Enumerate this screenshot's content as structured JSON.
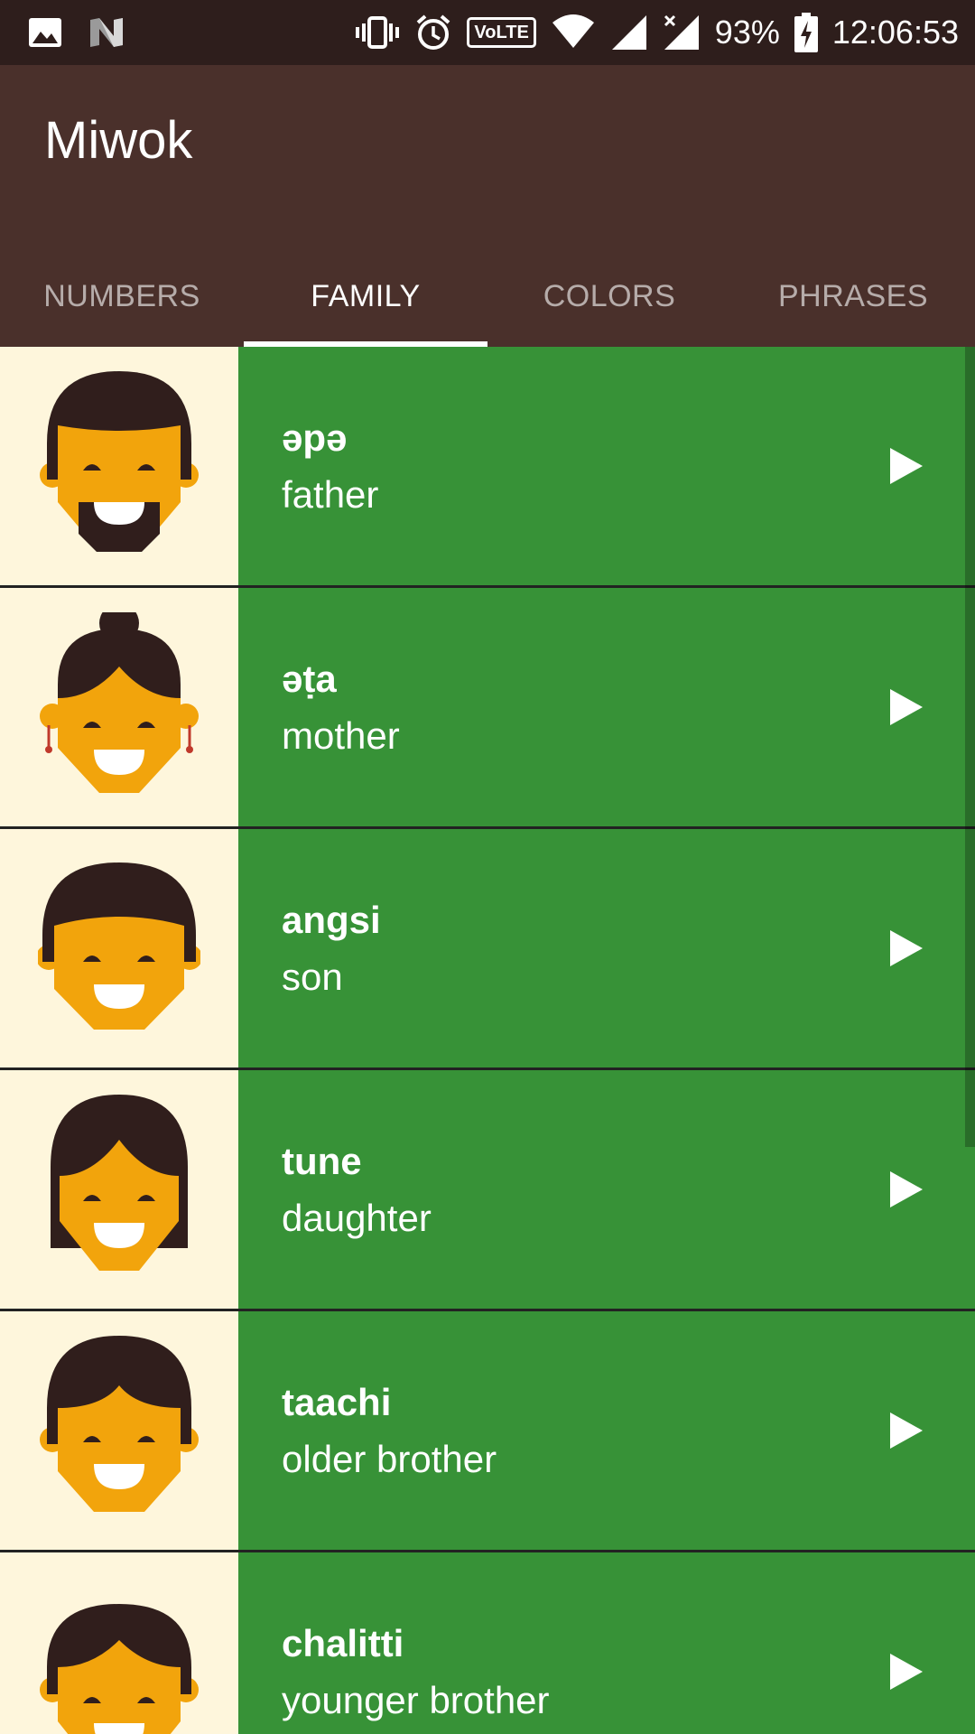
{
  "status_bar": {
    "icons_left": [
      "image-icon",
      "n-logo-icon"
    ],
    "icons_right": [
      "vibrate-icon",
      "alarm-icon",
      "volte-icon",
      "wifi-icon",
      "signal-icon",
      "signal-x-icon",
      "battery-charging-icon"
    ],
    "volte_label": "VoLTE",
    "battery": "93%",
    "time": "12:06:53"
  },
  "app": {
    "title": "Miwok"
  },
  "tabs": [
    {
      "label": "NUMBERS",
      "active": false
    },
    {
      "label": "FAMILY",
      "active": true
    },
    {
      "label": "COLORS",
      "active": false
    },
    {
      "label": "PHRASES",
      "active": false
    }
  ],
  "family": [
    {
      "miwok": "əpə",
      "english": "father",
      "avatar": "father-avatar-icon"
    },
    {
      "miwok": "əṭa",
      "english": "mother",
      "avatar": "mother-avatar-icon"
    },
    {
      "miwok": "angsi",
      "english": "son",
      "avatar": "son-avatar-icon"
    },
    {
      "miwok": "tune",
      "english": "daughter",
      "avatar": "daughter-avatar-icon"
    },
    {
      "miwok": "taachi",
      "english": "older brother",
      "avatar": "older-brother-avatar-icon"
    },
    {
      "miwok": "chalitti",
      "english": "younger brother",
      "avatar": "younger-brother-avatar-icon"
    }
  ],
  "colors": {
    "status_bar": "#2E1E1C",
    "app_bar": "#4A302B",
    "list_item": "#379237",
    "avatar_bg": "#FEF6DC",
    "skin": "#F2A40C",
    "hair": "#301E1C"
  }
}
